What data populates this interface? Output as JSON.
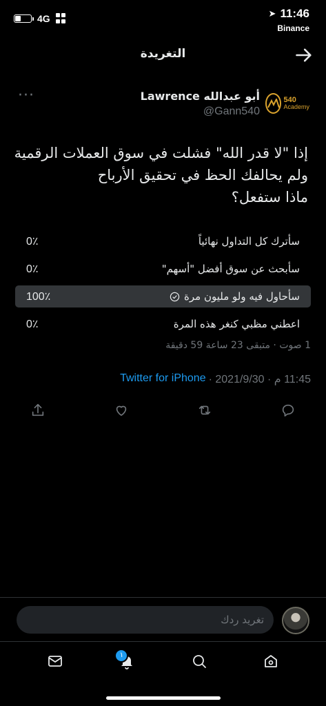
{
  "status_bar": {
    "network": "4G",
    "time": "11:46",
    "carrier": "Binance",
    "battery_level": 0.4
  },
  "header": {
    "title": "التغريدة"
  },
  "tweet": {
    "display_name": "أبو عبدالله Lawrence",
    "handle": "@Gann540",
    "logo_text": "540",
    "logo_subtext": "Academy",
    "text_lines": [
      "إذا \"لا قدر الله\" فشلت في سوق العملات الرقمية",
      "ولم يحالفك الحظ في تحقيق الأرباح",
      "ماذا ستفعل؟"
    ],
    "poll": {
      "options": [
        {
          "label": "سأترك كل التداول نهائياً",
          "percent": "0٪",
          "winner": false
        },
        {
          "label": "سأبحث عن سوق أفضل \"أسهم\"",
          "percent": "0٪",
          "winner": false
        },
        {
          "label": "سأحاول فيه ولو مليون مرة",
          "percent": "100٪",
          "winner": true
        },
        {
          "label": "اعطني مظبي كنغر هذه المرة",
          "percent": "0٪",
          "winner": false
        }
      ],
      "meta": "1 صوت · متبقى 23 ساعة 59 دقيقة"
    },
    "timestamp": "11:45 م · 2021/9/30 ·",
    "source": "Twitter for iPhone"
  },
  "reply": {
    "placeholder": "تغريد ردك"
  },
  "tabbar": {
    "notification_count": "١"
  }
}
